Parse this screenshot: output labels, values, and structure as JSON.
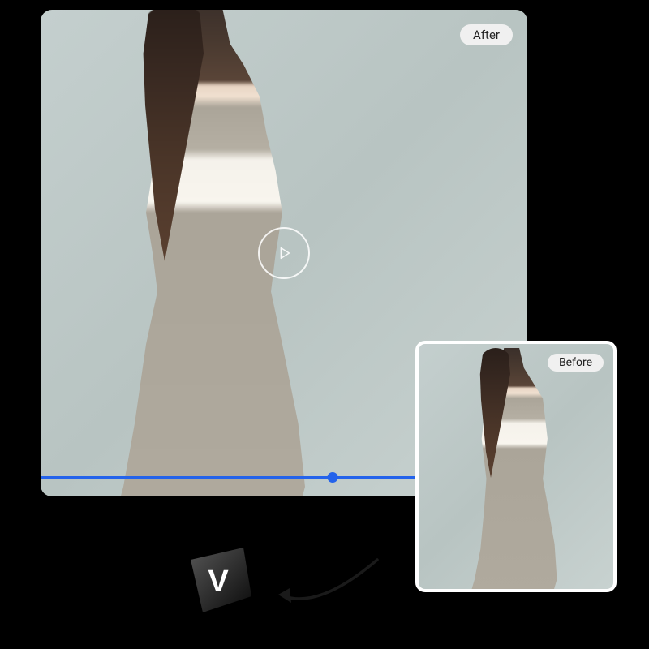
{
  "main_video": {
    "badge_label": "After",
    "progress_position_percent": 60
  },
  "thumbnail": {
    "badge_label": "Before"
  },
  "logo": {
    "letter": "V"
  },
  "colors": {
    "progress_bar": "#2463eb",
    "badge_bg": "#f0f0f0"
  }
}
